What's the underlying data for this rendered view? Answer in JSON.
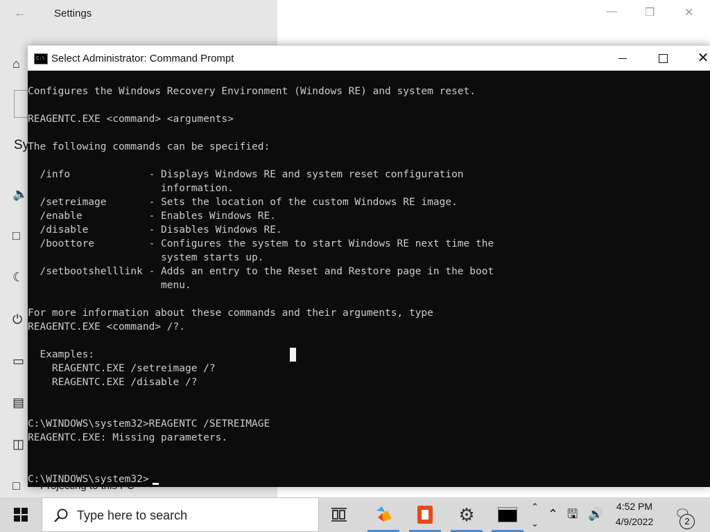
{
  "settings": {
    "title": "Settings",
    "partial_heading": "Sy",
    "bottom_item": "Projecting to this PC"
  },
  "cmd": {
    "title": "Select Administrator: Command Prompt",
    "app_icon_text": "C:\\",
    "lines": [
      "Configures the Windows Recovery Environment (Windows RE) and system reset.",
      "",
      "REAGENTC.EXE <command> <arguments>",
      "",
      "The following commands can be specified:",
      "",
      "  /info             - Displays Windows RE and system reset configuration",
      "                      information.",
      "  /setreimage       - Sets the location of the custom Windows RE image.",
      "  /enable           - Enables Windows RE.",
      "  /disable          - Disables Windows RE.",
      "  /boottore         - Configures the system to start Windows RE next time the",
      "                      system starts up.",
      "  /setbootshelllink - Adds an entry to the Reset and Restore page in the boot",
      "                      menu.",
      "",
      "For more information about these commands and their arguments, type",
      "REAGENTC.EXE <command> /?.",
      "",
      "  Examples:",
      "    REAGENTC.EXE /setreimage /?",
      "    REAGENTC.EXE /disable /?",
      "",
      "",
      "C:\\WINDOWS\\system32>REAGENTC /SETREIMAGE",
      "REAGENTC.EXE: Missing parameters.",
      "",
      "",
      "C:\\WINDOWS\\system32>"
    ]
  },
  "taskbar": {
    "search_placeholder": "Type here to search",
    "time": "4:52 PM",
    "date": "4/9/2022",
    "notification_count": "2"
  }
}
